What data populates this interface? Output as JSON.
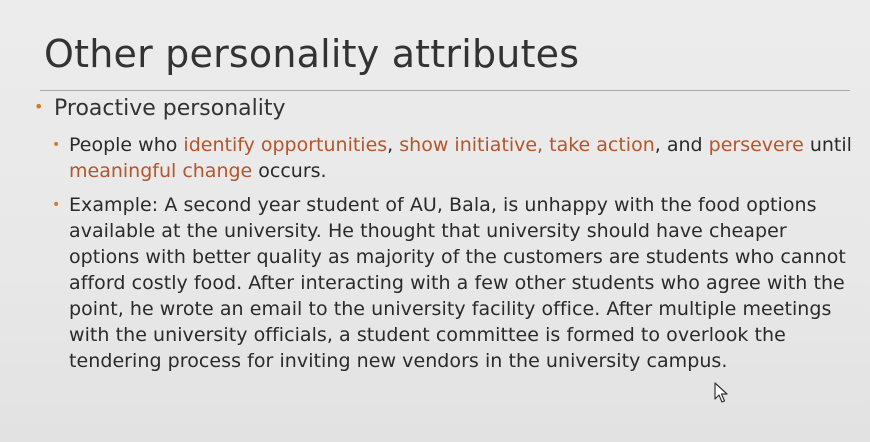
{
  "slide": {
    "title": "Other personality attributes",
    "level1": {
      "bullet": "•",
      "label": "Proactive personality"
    },
    "item1": {
      "bullet": "•",
      "part1": "People who ",
      "hl1": "identify opportunities",
      "part2": ", ",
      "hl2": "show initiative, take action",
      "part3": ", and ",
      "hl3": "persevere",
      "part4": " until ",
      "hl4": "meaningful change",
      "part5": " occurs."
    },
    "item2": {
      "bullet": "•",
      "text": "Example: A second year student of AU, Bala, is unhappy with the food options available at the university. He thought that university should have cheaper options with better quality as majority of the customers are students who cannot afford costly food. After interacting with a few other students who agree with the point, he wrote an email to the university facility office. After multiple meetings with the university officials, a student committee is formed to overlook the tendering process for inviting new vendors in the university campus."
    }
  },
  "colors": {
    "highlight": "#b5552a",
    "bullet": "#d07a2a",
    "text": "#2a2a2a",
    "background": "#e9e9e9"
  },
  "icons": {
    "cursor": "mouse-pointer-icon"
  }
}
